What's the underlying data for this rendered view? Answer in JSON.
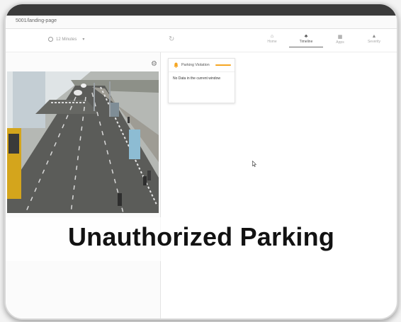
{
  "browser": {
    "url": "5001/landing-page"
  },
  "header": {
    "time_range": "12 Minutes",
    "nav": [
      {
        "label": "Home",
        "icon": "home-icon"
      },
      {
        "label": "Timeline",
        "icon": "timeline-icon",
        "active": true
      },
      {
        "label": "Apps",
        "icon": "apps-icon"
      },
      {
        "label": "Severity",
        "icon": "severity-icon"
      }
    ]
  },
  "card": {
    "title": "Parking Violation",
    "accent_color": "#f5a623",
    "body": "No Data in the current window"
  },
  "caption": "Unauthorized Parking"
}
